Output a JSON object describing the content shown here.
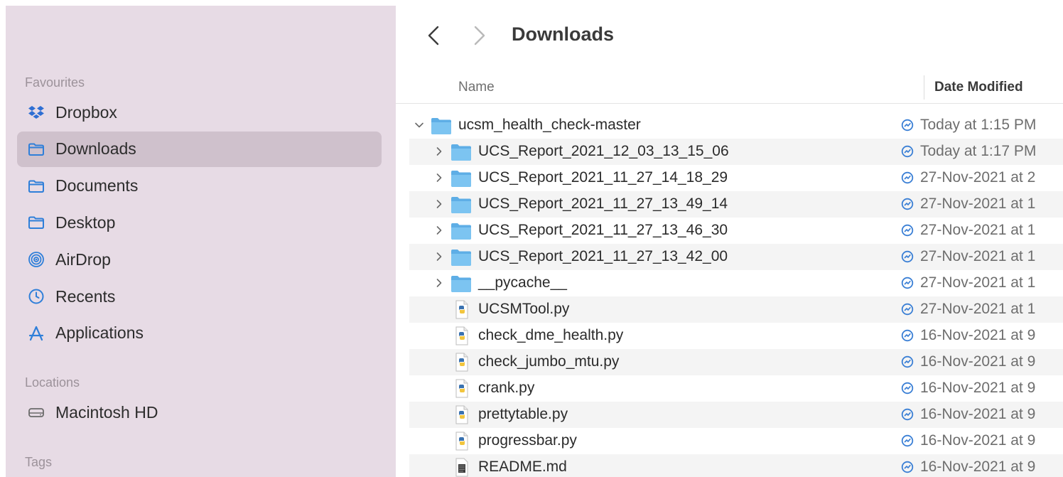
{
  "sidebar": {
    "favourites_label": "Favourites",
    "favourites": [
      {
        "label": "Dropbox",
        "icon": "dropbox-icon"
      },
      {
        "label": "Downloads",
        "icon": "folder-icon",
        "selected": true
      },
      {
        "label": "Documents",
        "icon": "folder-icon"
      },
      {
        "label": "Desktop",
        "icon": "folder-icon"
      },
      {
        "label": "AirDrop",
        "icon": "airdrop-icon"
      },
      {
        "label": "Recents",
        "icon": "clock-icon"
      },
      {
        "label": "Applications",
        "icon": "applications-icon"
      }
    ],
    "locations_label": "Locations",
    "locations": [
      {
        "label": "Macintosh HD",
        "icon": "harddrive-icon"
      }
    ],
    "tags_label": "Tags"
  },
  "toolbar": {
    "title": "Downloads",
    "back_icon": "chevron-left-icon",
    "forward_icon": "chevron-right-icon"
  },
  "columns": {
    "name": "Name",
    "date_modified": "Date Modified"
  },
  "files": [
    {
      "name": "ucsm_health_check-master",
      "type": "folder",
      "depth": 0,
      "expanded": true,
      "date": "Today at 1:15 PM"
    },
    {
      "name": "UCS_Report_2021_12_03_13_15_06",
      "type": "folder",
      "depth": 1,
      "expanded": false,
      "date": "Today at 1:17 PM"
    },
    {
      "name": "UCS_Report_2021_11_27_14_18_29",
      "type": "folder",
      "depth": 1,
      "expanded": false,
      "date": "27-Nov-2021 at 2"
    },
    {
      "name": "UCS_Report_2021_11_27_13_49_14",
      "type": "folder",
      "depth": 1,
      "expanded": false,
      "date": "27-Nov-2021 at 1"
    },
    {
      "name": "UCS_Report_2021_11_27_13_46_30",
      "type": "folder",
      "depth": 1,
      "expanded": false,
      "date": "27-Nov-2021 at 1"
    },
    {
      "name": "UCS_Report_2021_11_27_13_42_00",
      "type": "folder",
      "depth": 1,
      "expanded": false,
      "date": "27-Nov-2021 at 1"
    },
    {
      "name": "__pycache__",
      "type": "folder",
      "depth": 1,
      "expanded": false,
      "date": "27-Nov-2021 at 1"
    },
    {
      "name": "UCSMTool.py",
      "type": "python",
      "depth": 1,
      "date": "27-Nov-2021 at 1"
    },
    {
      "name": "check_dme_health.py",
      "type": "python",
      "depth": 1,
      "date": "16-Nov-2021 at 9"
    },
    {
      "name": "check_jumbo_mtu.py",
      "type": "python",
      "depth": 1,
      "date": "16-Nov-2021 at 9"
    },
    {
      "name": "crank.py",
      "type": "python",
      "depth": 1,
      "date": "16-Nov-2021 at 9"
    },
    {
      "name": "prettytable.py",
      "type": "python",
      "depth": 1,
      "date": "16-Nov-2021 at 9"
    },
    {
      "name": "progressbar.py",
      "type": "python",
      "depth": 1,
      "date": "16-Nov-2021 at 9"
    },
    {
      "name": "README.md",
      "type": "text",
      "depth": 1,
      "date": "16-Nov-2021 at 9"
    }
  ],
  "colors": {
    "sidebar_bg": "#e7dbe5",
    "sidebar_selected": "#cfc1cc",
    "folder_blue": "#6fb6e8",
    "sync_blue": "#3a7fd5",
    "accent_blue": "#2f7fd9"
  }
}
